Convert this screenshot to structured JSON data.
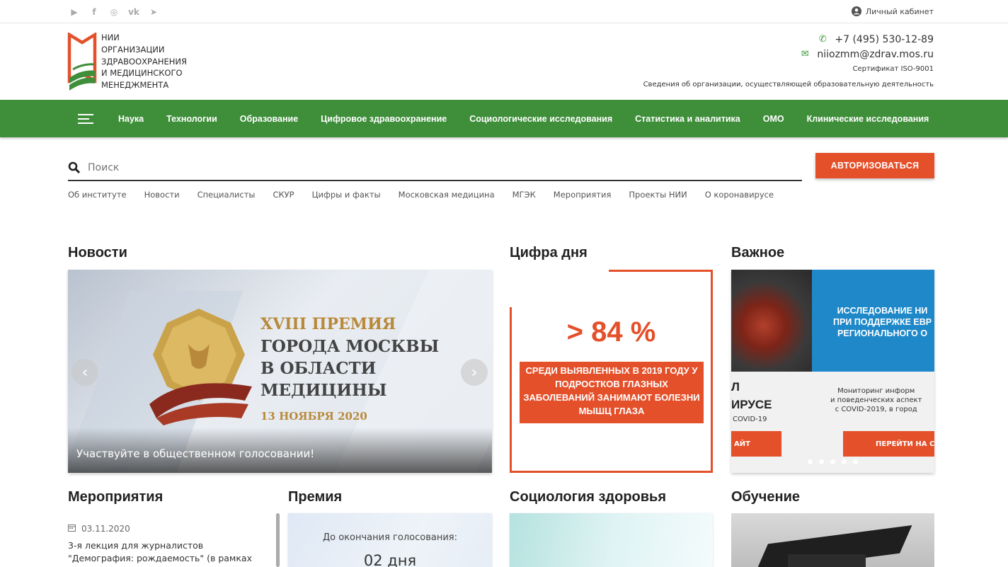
{
  "topbar": {
    "socials": [
      {
        "icon": "youtube-icon",
        "glyph": "▶"
      },
      {
        "icon": "facebook-icon",
        "glyph": "f"
      },
      {
        "icon": "instagram-icon",
        "glyph": "◎"
      },
      {
        "icon": "vk-icon",
        "glyph": "vk"
      },
      {
        "icon": "telegram-icon",
        "glyph": "➤"
      }
    ],
    "cabinet_label": "Личный кабинет"
  },
  "logo": {
    "lines": [
      "НИИ",
      "ОРГАНИЗАЦИИ",
      "ЗДРАВООХРАНЕНИЯ",
      "И МЕДИЦИНСКОГО",
      "МЕНЕДЖМЕНТА"
    ],
    "colors": {
      "red": "#e4502a",
      "green": "#3e8e3a"
    }
  },
  "contacts": {
    "phone": "+7 (495) 530-12-89",
    "email": "niiozmm@zdrav.mos.ru",
    "certificate": "Сертификат ISO-9001",
    "org_info": "Сведения об организации, осуществляющей образовательную деятельность"
  },
  "nav": {
    "items": [
      "Наука",
      "Технологии",
      "Образование",
      "Цифровое здравоохранение",
      "Социологические исследования",
      "Статистика и аналитика",
      "ОМО",
      "Клинические исследования"
    ],
    "color": "#3e8e3a"
  },
  "search": {
    "placeholder": "Поиск"
  },
  "auth_button": "АВТОРИЗОВАТЬСЯ",
  "subnav": [
    "Об институте",
    "Новости",
    "Специалисты",
    "СКУР",
    "Цифры и факты",
    "Московская медицина",
    "МГЭК",
    "Мероприятия",
    "Проекты НИИ",
    "О коронавирусе"
  ],
  "sections": {
    "news": "Новости",
    "digit": "Цифра дня",
    "important": "Важное",
    "events": "Мероприятия",
    "award": "Премия",
    "sociology": "Социология здоровья",
    "education": "Обучение"
  },
  "news": {
    "slide_line1": "XVIII ПРЕМИЯ",
    "slide_line2": "ГОРОДА МОСКВЫ",
    "slide_line3": "В ОБЛАСТИ",
    "slide_line4": "МЕДИЦИНЫ",
    "slide_date": "13 НОЯБРЯ 2020",
    "caption": "Участвуйте в общественном голосовании!",
    "prev": "‹",
    "next": "›"
  },
  "digit": {
    "value": "> 84 %",
    "description": "СРЕДИ ВЫЯВЛЕННЫХ В 2019 ГОДУ У ПОДРОСТКОВ ГЛАЗНЫХ ЗАБОЛЕВАНИЙ ЗАНИМАЮТ БОЛЕЗНИ МЫШЦ ГЛАЗА",
    "accent": "#e4502a"
  },
  "important": {
    "blue_text": "ИССЛЕДОВАНИЕ НИ\nПРИ ПОДДЕРЖКЕ ЕВР\nРЕГИОНАЛЬНОГО О",
    "left_line1": "Л",
    "left_line2": "ИРУСЕ",
    "left_line3": "COVID-19",
    "right_text": "Мониторинг информ\nи поведенческих аспект\nс COVID-2019, в город",
    "btn_left": "АЙТ",
    "btn_right": "ПЕРЕЙТИ НА С"
  },
  "events": {
    "date": "03.11.2020",
    "text": "3-я лекция для журналистов \"Демография: рождаемость\" (в рамках"
  },
  "award": {
    "label": "До окончания голосования:",
    "days": "02 дня"
  }
}
